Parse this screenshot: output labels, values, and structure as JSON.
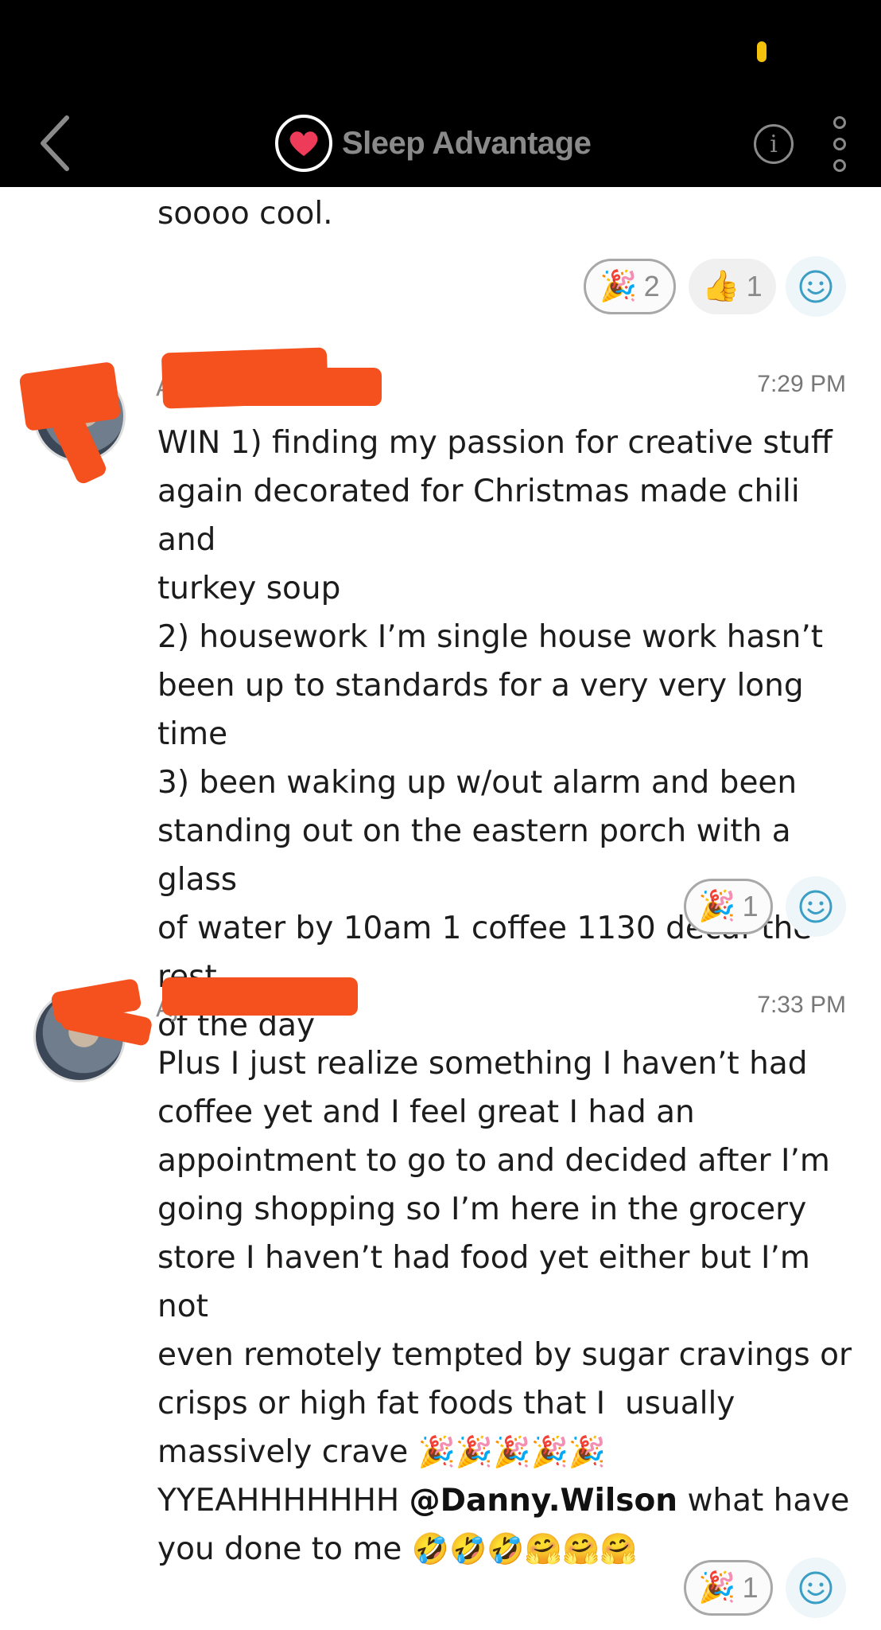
{
  "header": {
    "title": "Sleep Advantage",
    "colors": {
      "background": "#000000",
      "title": "#8a8a8a",
      "heart": "#ef3b5a",
      "status": "#f4c20d"
    }
  },
  "messages": [
    {
      "text": "soooo cool.",
      "reactions": [
        {
          "icon": "party-popper",
          "count": "2",
          "selected": true
        },
        {
          "icon": "thumbs-up",
          "count": "1",
          "selected": false
        }
      ]
    },
    {
      "author_visible": "A",
      "time": "7:29 PM",
      "text": "WIN 1) finding my passion for creative stuff\nagain decorated for Christmas made chili and\nturkey soup\n2) housework I’m single house work hasn’t\nbeen up to standards for a very very long time\n3) been waking up w/out alarm and been\nstanding out on the eastern porch with a glass\nof water by 10am 1 coffee 1130 decaf the rest\nof the day",
      "reactions": [
        {
          "icon": "party-popper",
          "count": "1",
          "selected": true
        }
      ]
    },
    {
      "author_visible": "AJ",
      "time": "7:33 PM",
      "text": "Plus I just realize something I haven’t had\ncoffee yet and I feel great I had an\nappointment to go to and decided after I’m\ngoing shopping so I’m here in the grocery\nstore I haven’t had food yet either but I’m not\neven remotely tempted by sugar cravings or\ncrisps or high fat foods that I  usually\nmassively crave",
      "emoji_line_1": "🎉🎉🎉🎉🎉",
      "line_yeah": "YYEAHHHHHHH ",
      "mention": "@Danny.Wilson",
      "after_mention": " what have",
      "last_line": "you done to me ",
      "emoji_line_2": "🤣🤣🤣🤗🤗🤗",
      "reactions": [
        {
          "icon": "party-popper",
          "count": "1",
          "selected": true
        }
      ]
    }
  ]
}
